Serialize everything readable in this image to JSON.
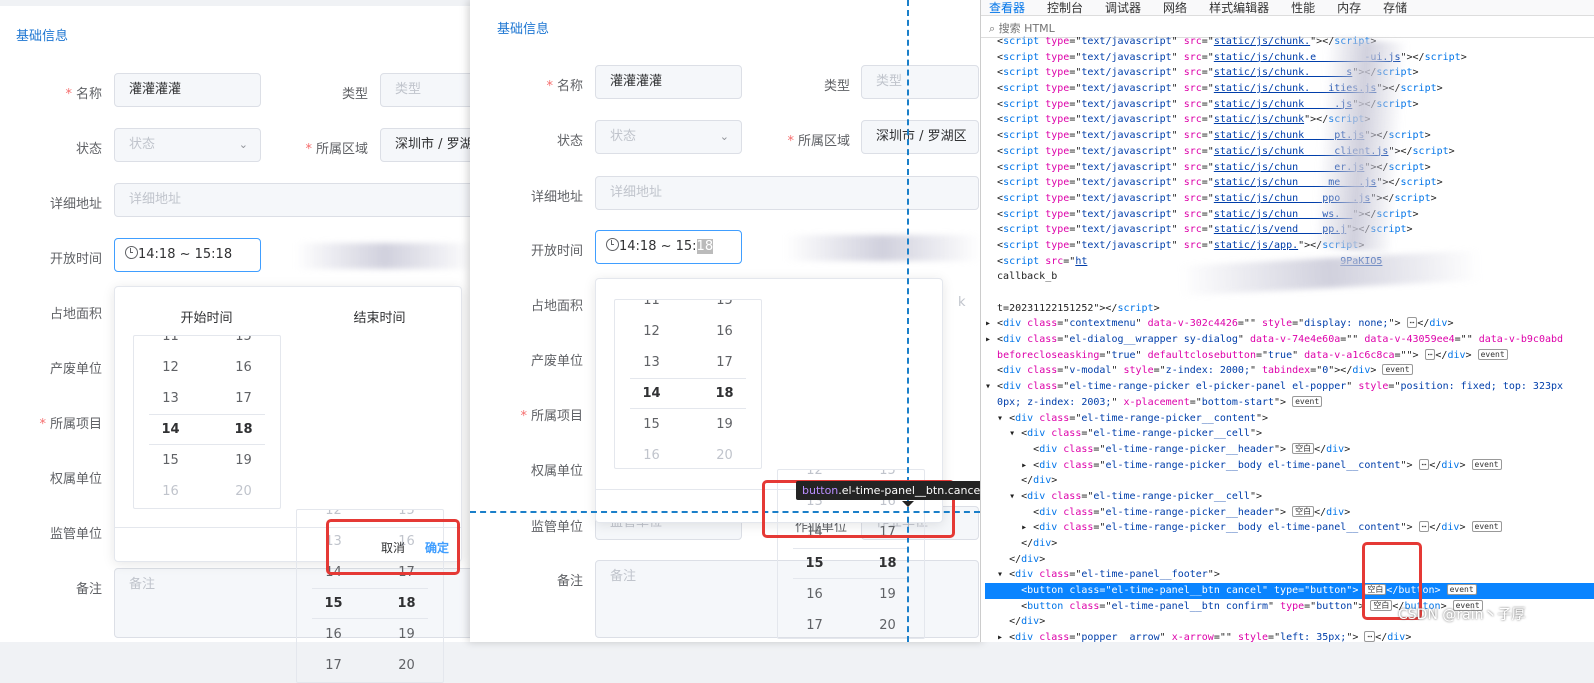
{
  "left": {
    "section": "基础信息",
    "labels": {
      "name": "名称",
      "type": "类型",
      "status": "状态",
      "region": "所属区域",
      "address": "详细地址",
      "open_time": "开放时间",
      "area": "占地面积",
      "waste_unit": "产废单位",
      "project": "所属项目",
      "owner_unit": "权属单位",
      "supervise_unit": "监管单位",
      "remark": "备注"
    },
    "values": {
      "name": "灌灌灌灌",
      "region": "深圳市 / 罗湖",
      "time": "14:18 ~ 15:18"
    },
    "placeholders": {
      "type": "类型",
      "status": "状态",
      "address": "详细地址",
      "remark": "备注"
    },
    "picker": {
      "start_title": "开始时间",
      "end_title": "结束时间",
      "start_hours": [
        "11",
        "12",
        "13",
        "14",
        "15",
        "16"
      ],
      "start_minutes": [
        "15",
        "16",
        "17",
        "18",
        "19",
        "20"
      ],
      "end_hours": [
        "12",
        "13",
        "14",
        "15",
        "16",
        "17"
      ],
      "end_minutes": [
        "15",
        "16",
        "17",
        "18",
        "19",
        "20"
      ],
      "cancel": "取消",
      "confirm": "确定"
    }
  },
  "middle": {
    "section": "基础信息",
    "labels": {
      "name": "名称",
      "type": "类型",
      "status": "状态",
      "region": "所属区域",
      "address": "详细地址",
      "open_time": "开放时间",
      "area": "占地面积",
      "waste_unit": "产废单位",
      "project": "所属项目",
      "owner_unit": "权属单位",
      "supervise_unit": "监管单位",
      "remark": "备注"
    },
    "values": {
      "name": "灌灌灌灌",
      "region": "深圳市 / 罗湖区",
      "time_prefix": "14:18 ~ 15:",
      "time_suffix": "18",
      "unit_k": "k"
    },
    "placeholders": {
      "type": "类型",
      "status": "状态",
      "address": "详细地址",
      "supervise": "监管单位",
      "work_unit_label": "作业单位",
      "work_unit": "作业单位",
      "remark": "备注"
    },
    "picker": {
      "start_hours": [
        "11",
        "12",
        "13",
        "14",
        "15",
        "16"
      ],
      "start_minutes": [
        "15",
        "16",
        "17",
        "18",
        "19",
        "20"
      ],
      "end_hours": [
        "12",
        "13",
        "14",
        "15",
        "16",
        "17"
      ],
      "end_minutes": [
        "15",
        "16",
        "17",
        "18",
        "19",
        "20"
      ]
    },
    "tooltip": {
      "tag": "button",
      "cls": ".el-time-panel__btn.cancel"
    }
  },
  "devtools": {
    "tabs": [
      "查看器",
      "控制台",
      "调试器",
      "网络",
      "样式编辑器",
      "性能",
      "内存",
      "存储"
    ],
    "search_placeholder": "搜索 HTML",
    "blank": "空白",
    "event": "event",
    "watermark": "CSDN @rain丶子厚"
  }
}
